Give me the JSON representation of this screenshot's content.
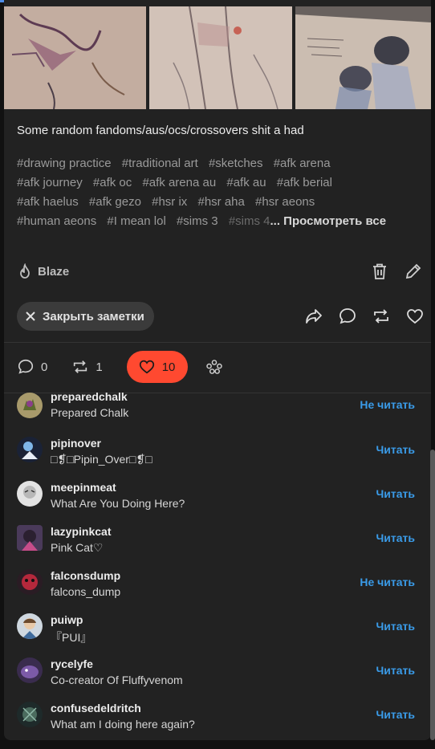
{
  "post": {
    "caption": "Some random fandoms/aus/ocs/crossovers shit a had",
    "tags": [
      "#drawing practice",
      "#traditional art",
      "#sketches",
      "#afk arena",
      "#afk journey",
      "#afk oc",
      "#afk arena au",
      "#afk au",
      "#afk berial",
      "#afk haelus",
      "#afk gezo",
      "#hsr ix",
      "#hsr aha",
      "#hsr aeons",
      "#human aeons",
      "#I mean lol",
      "#sims 3"
    ],
    "tag_faded": "#sims 4",
    "view_all": "... Просмотреть все",
    "blaze_label": "Blaze"
  },
  "notes": {
    "close_label": "Закрыть заметки",
    "stats": {
      "replies": "0",
      "reblogs": "1",
      "likes": "10"
    }
  },
  "colors": {
    "like": "#ff4930",
    "follow": "#3a9be8",
    "background": "#222222"
  },
  "icons": [
    "flame-icon",
    "trash-icon",
    "pencil-icon",
    "close-icon",
    "share-icon",
    "comment-icon",
    "reblog-icon",
    "heart-icon",
    "community-icon"
  ],
  "likers": [
    {
      "username": "preparedchalk",
      "display": "Prepared Chalk",
      "action": "Не читать"
    },
    {
      "username": "pipinover",
      "display": "□❡□Pipin_Over□❡□",
      "action": "Читать"
    },
    {
      "username": "meepinmeat",
      "display": "What Are You Doing Here?",
      "action": "Читать"
    },
    {
      "username": "lazypinkcat",
      "display": "Pink Cat♡",
      "action": "Читать"
    },
    {
      "username": "falconsdump",
      "display": "falcons_dump",
      "action": "Не читать"
    },
    {
      "username": "puiwp",
      "display": "『PUI』",
      "action": "Читать"
    },
    {
      "username": "rycelyfe",
      "display": "Co-creator Of Fluffyvenom",
      "action": "Читать"
    },
    {
      "username": "confusedeldritch",
      "display": "What am I doing here again?",
      "action": "Читать"
    }
  ]
}
